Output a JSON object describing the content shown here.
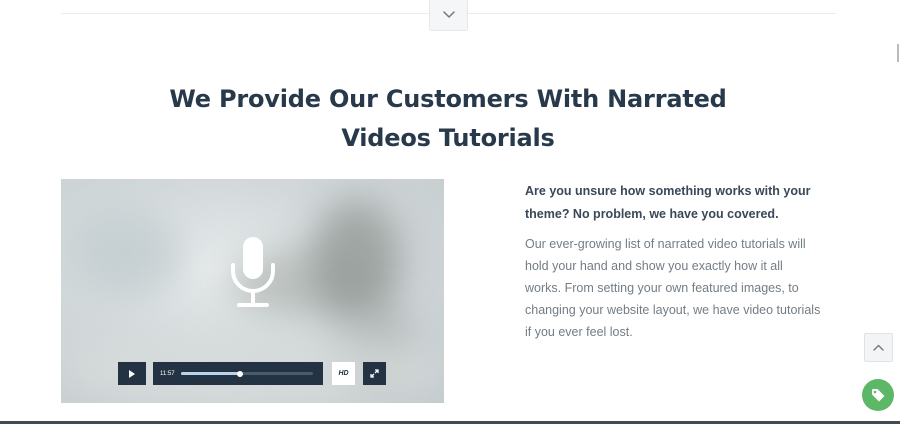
{
  "header": {
    "toggle_icon": "chevron-down-icon"
  },
  "section": {
    "title_line1": "We Provide Our Customers With Narrated",
    "title_line2": "Videos Tutorials",
    "lead_line1": "Are you unsure how something works with your",
    "lead_line2": "theme? No problem, we have you covered.",
    "body_line1": "Our ever-growing list of narrated video tutorials will",
    "body_line2": "hold your hand and show you exactly how it all",
    "body_line3": "works. From setting your own featured images, to",
    "body_line4": "changing your website layout, we have video tutorials",
    "body_line5": "if you ever feel lost."
  },
  "video": {
    "center_icon": "microphone-icon",
    "time": "11:57",
    "progress": 0.45,
    "hd_label": "HD",
    "play_icon": "play-icon",
    "fullscreen_icon": "fullscreen-icon"
  },
  "floating": {
    "scroll_top_icon": "chevron-up-icon",
    "tag_icon": "tag-icon"
  },
  "colors": {
    "heading": "#27394b",
    "player_controls": "#233344",
    "progress_fill": "#b9d3ec",
    "tag_button": "#5cb866"
  }
}
